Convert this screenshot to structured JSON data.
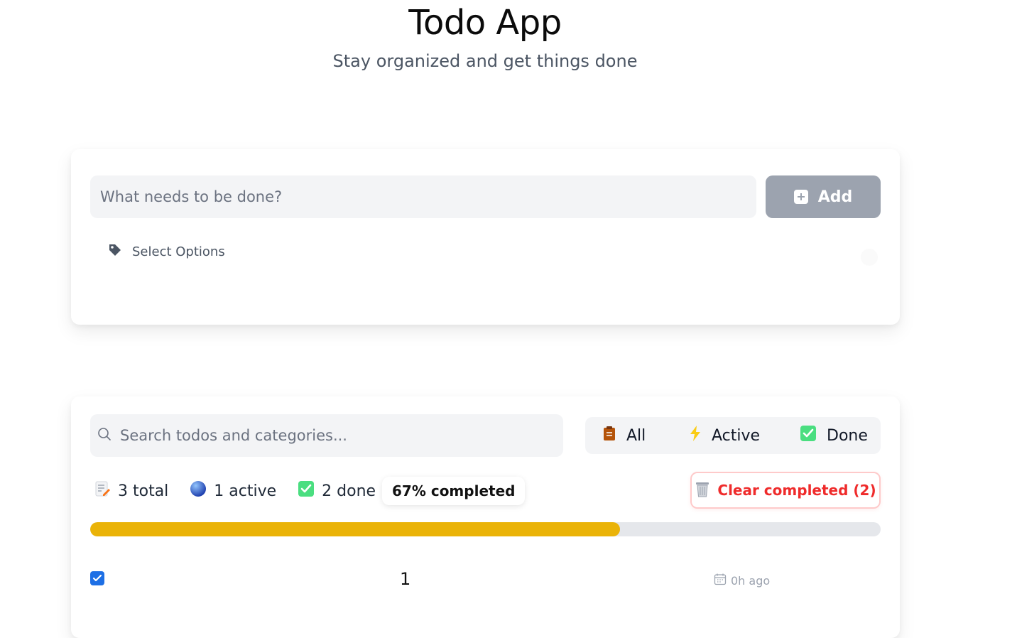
{
  "header": {
    "title": "Todo App",
    "subtitle": "Stay organized and get things done"
  },
  "add_form": {
    "input_placeholder": "What needs to be done?",
    "input_value": "",
    "add_label": "Add",
    "options_label": "Select Options"
  },
  "list": {
    "search_placeholder": "Search todos and categories...",
    "filters": [
      {
        "label": "All",
        "icon": "clipboard-icon"
      },
      {
        "label": "Active",
        "icon": "lightning-icon"
      },
      {
        "label": "Done",
        "icon": "check-box-icon"
      }
    ],
    "stats": {
      "total": "3 total",
      "active": "1 active",
      "done": "2 done",
      "completed_pct": "67% completed"
    },
    "clear_label": "Clear completed (2)",
    "progress": 0.67,
    "todos": [
      {
        "text": "1",
        "time": "0h ago",
        "checked": true
      }
    ]
  },
  "colors": {
    "accent_blue": "#1d6fe5",
    "progress_yellow": "#eab308",
    "danger_red": "#ef2b2b",
    "add_button_gray": "#9ca3af"
  }
}
